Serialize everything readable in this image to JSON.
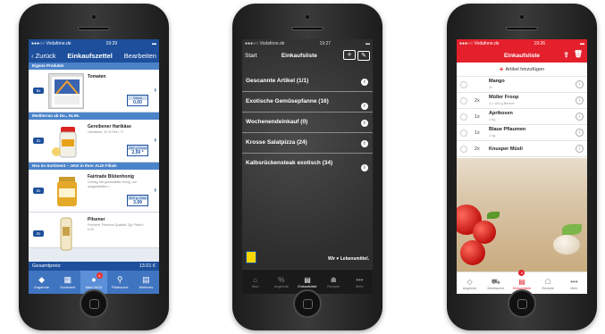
{
  "colors": {
    "aldi_blue": "#1d4f9c",
    "aldi_light": "#4b83c9",
    "edeka_red": "#e3202b",
    "chalkboard": "#2d2d2d"
  },
  "phone1": {
    "status": {
      "carrier": "●●●○○ Vodafone.de",
      "time": "19:29"
    },
    "nav": {
      "back": "Zurück",
      "title": "Einkaufszettel",
      "action": "Bearbeiten"
    },
    "sections": [
      {
        "header": "Eigene Produkte",
        "product": {
          "qty": "5x",
          "name": "Tomaten",
          "desc": "",
          "price_label": "Stück",
          "price": "0.00"
        }
      },
      {
        "header": "Mediterran ab Do., 04.06.",
        "product": {
          "qty": "2x",
          "name": "Gereibener Hartkäse",
          "desc": "Gebrieben, 32 % Fett i. Tr.",
          "price_label": "250 g-Dose",
          "price": "2.59 *"
        }
      },
      {
        "header": "Neu im Sortiment – Jetzt in Ihrer ALDI Filiale",
        "product": {
          "qty": "2x",
          "name": "Fairtrade Blütenhonig",
          "desc": "Cremig, fair gehandelter Honig, von ausgewählten I…",
          "price_label": "500 g-Glas",
          "price": "3.99"
        }
      },
      {
        "header": "",
        "product": {
          "qty": "2x",
          "name": "Pilsener",
          "desc": "Feinherb, Premium Qualität, Zgl. Pfand + 0.25",
          "price_label": "",
          "price": ""
        }
      }
    ],
    "total": {
      "label": "Gesamtpreis:",
      "value": "13.01 €"
    },
    "tabs": [
      {
        "icon": "angebote-icon",
        "glyph": "◆",
        "label": "Angebote"
      },
      {
        "icon": "sortiment-icon",
        "glyph": "▦",
        "label": "Sortiment"
      },
      {
        "icon": "mein-aldi-icon",
        "glyph": "●",
        "label": "Mein ALDI",
        "badge": "4",
        "active": true
      },
      {
        "icon": "filialsuche-icon",
        "glyph": "⚲",
        "label": "Filialsuche"
      },
      {
        "icon": "weiteres-icon",
        "glyph": "▤",
        "label": "Weiteres"
      }
    ]
  },
  "phone2": {
    "status": {
      "carrier": "●●●○○ Vodafone.de",
      "time": "19:27"
    },
    "nav": {
      "back": "Start",
      "title": "Einkaufsliste",
      "add": "+",
      "edit": "✎"
    },
    "lists": [
      {
        "label": "Gescannte Artikel (1/1)"
      },
      {
        "label": "Exotische Gemüsepfanne (16)"
      },
      {
        "label": "Wochenendeinkauf (0)"
      },
      {
        "label": "Krosse Salatpizza (24)"
      },
      {
        "label": "Kalbsrückensteak exotisch (34)"
      }
    ],
    "slogan": "Wir ♥ Lebensmittel.",
    "tabs": [
      {
        "icon": "start-icon",
        "glyph": "⌂",
        "label": "Start"
      },
      {
        "icon": "angebote-icon",
        "glyph": "%",
        "label": "Angebote"
      },
      {
        "icon": "einkaufsliste-icon",
        "glyph": "▤",
        "label": "Einkaufsliste",
        "active": true
      },
      {
        "icon": "rezepte-icon",
        "glyph": "☗",
        "label": "Rezepte"
      },
      {
        "icon": "mehr-icon",
        "glyph": "•••",
        "label": "Mehr"
      }
    ]
  },
  "phone3": {
    "status": {
      "carrier": "●●●○○ Vodafone.de",
      "time": "19:26"
    },
    "nav": {
      "title": "Einkaufsliste"
    },
    "add_label": "Artikel hinzufügen",
    "items": [
      {
        "qty": "",
        "name": "Mango",
        "sub": "3x"
      },
      {
        "qty": "2x",
        "name": "Müller Froop",
        "sub": "4 x 150 g-Becher"
      },
      {
        "qty": "1x",
        "name": "Aprikosen",
        "sub": "1 kg"
      },
      {
        "qty": "1x",
        "name": "Blaue Pflaumen",
        "sub": "1 kg"
      },
      {
        "qty": "2x",
        "name": "Knusper Müsli",
        "sub": ""
      }
    ],
    "tabs": [
      {
        "icon": "angebote-icon",
        "glyph": "◇",
        "label": "Angebote"
      },
      {
        "icon": "marktsuche-icon",
        "glyph": "⛟",
        "label": "Marktsuche"
      },
      {
        "icon": "einkaufsliste-icon",
        "glyph": "▤",
        "label": "Einkaufsliste",
        "badge": "8",
        "active": true
      },
      {
        "icon": "rezepte-icon",
        "glyph": "☖",
        "label": "Rezepte"
      },
      {
        "icon": "mehr-icon",
        "glyph": "•••",
        "label": "Mehr"
      }
    ]
  }
}
